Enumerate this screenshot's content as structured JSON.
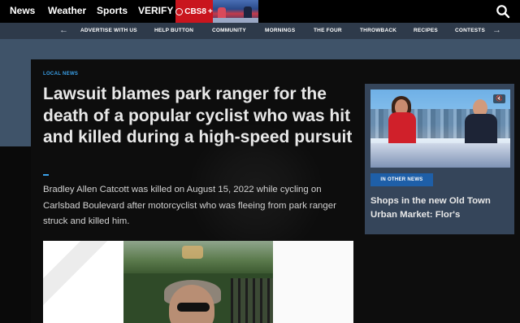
{
  "topnav": {
    "items": [
      "News",
      "Weather",
      "Sports",
      "VERIFY"
    ],
    "brand_tab": "CBS8",
    "brand_plus": "+",
    "search_icon": "search-icon"
  },
  "subnav": {
    "items": [
      "ADVERTISE WITH US",
      "HELP BUTTON",
      "COMMUNITY",
      "MORNINGS",
      "THE FOUR",
      "THROWBACK",
      "RECIPES",
      "CONTESTS"
    ],
    "prev_arrow": "←",
    "next_arrow": "→"
  },
  "article": {
    "tag": "LOCAL NEWS",
    "headline": "Lawsuit blames park ranger for the death of a popular cyclist who was hit and killed during a high-speed pursuit",
    "summary": "Bradley Allen Catcott was killed on August 15, 2022 while cycling on Carlsbad Boulevard after motorcyclist who was fleeing from park ranger struck and killed him."
  },
  "rail": {
    "badge": "IN OTHER NEWS",
    "headline": "Shops in the new Old Town Urban Market: Flor's",
    "mute_icon": "🔇"
  },
  "colors": {
    "accent_blue": "#3aa0e8",
    "brand_red": "#c9151e",
    "band": "#3f5369",
    "subnav_bg": "#2e3a4a"
  }
}
